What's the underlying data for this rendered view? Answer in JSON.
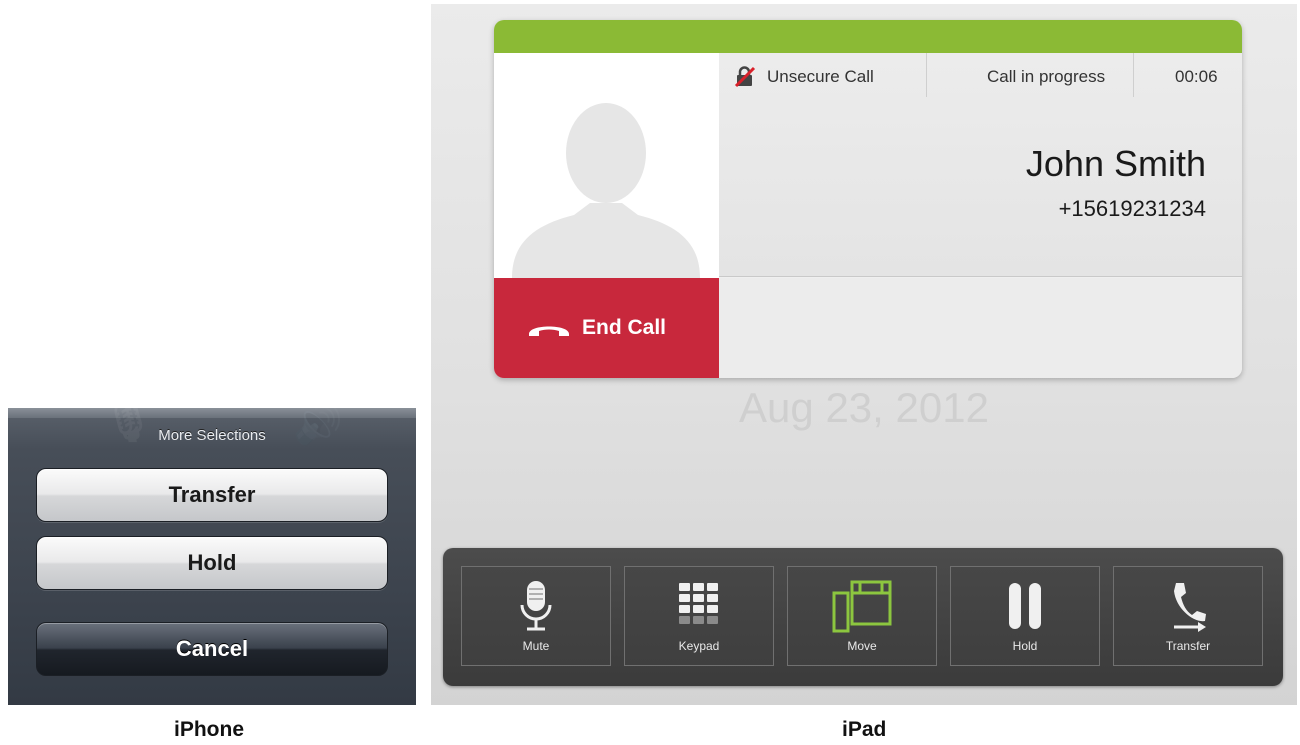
{
  "iphone": {
    "sheet_title": "More Selections",
    "buttons": [
      {
        "label": "Transfer"
      },
      {
        "label": "Hold"
      },
      {
        "label": "Cancel"
      }
    ],
    "caption": "iPhone"
  },
  "ipad": {
    "status": {
      "security": "Unsecure Call",
      "state": "Call in progress",
      "timer": "00:06"
    },
    "caller": {
      "name": "John Smith",
      "number": "+15619231234"
    },
    "end_call_label": "End Call",
    "date": "Aug 23, 2012",
    "toolbar": [
      {
        "label": "Mute",
        "icon": "microphone-icon"
      },
      {
        "label": "Keypad",
        "icon": "keypad-icon"
      },
      {
        "label": "Move",
        "icon": "move-icon"
      },
      {
        "label": "Hold",
        "icon": "pause-icon"
      },
      {
        "label": "Transfer",
        "icon": "transfer-icon"
      }
    ],
    "caption": "iPad",
    "colors": {
      "accent_green": "#8bba35",
      "end_call_red": "#c8283c",
      "move_icon_green": "#8cc63f"
    }
  }
}
